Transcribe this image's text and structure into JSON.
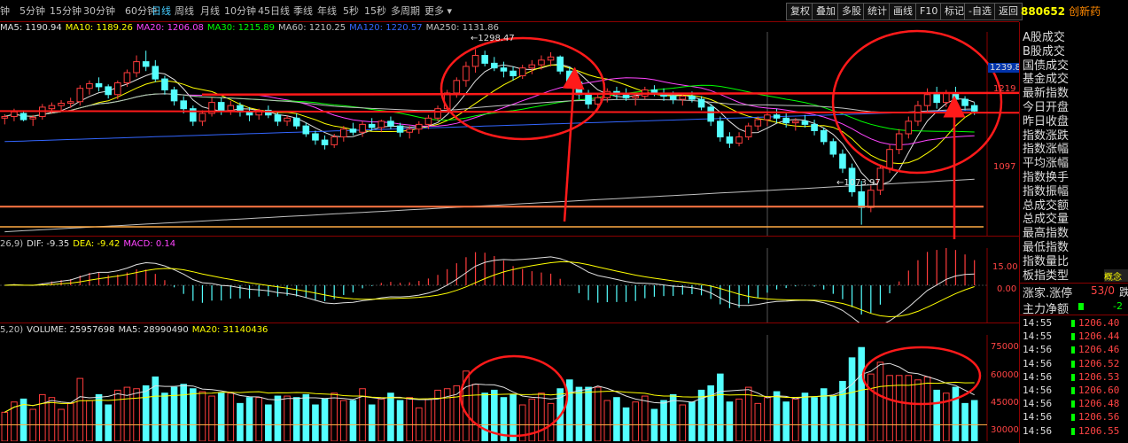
{
  "toolbar": {
    "timeframes": [
      {
        "label": "钟",
        "active": false
      },
      {
        "label": "5分钟",
        "active": false
      },
      {
        "label": "15分钟",
        "active": false
      },
      {
        "label": "30分钟",
        "active": false
      },
      {
        "label": "60分钟",
        "active": false
      },
      {
        "label": "日线",
        "active": true
      },
      {
        "label": "周线",
        "active": false
      },
      {
        "label": "月线",
        "active": false
      },
      {
        "label": "10分钟",
        "active": false
      },
      {
        "label": "45日线",
        "active": false
      },
      {
        "label": "季线",
        "active": false
      },
      {
        "label": "年线",
        "active": false
      },
      {
        "label": "5秒",
        "active": false
      },
      {
        "label": "15秒",
        "active": false
      },
      {
        "label": "多周期",
        "active": false
      },
      {
        "label": "更多 ▾",
        "active": false
      }
    ],
    "tools": [
      "复权",
      "叠加",
      "多股",
      "统计",
      "画线",
      "F10",
      "标记",
      "-自选",
      "返回"
    ]
  },
  "stock": {
    "code": "880652",
    "name": "创新药"
  },
  "price_legend": {
    "items": [
      {
        "text": "MA5: 1190.94",
        "color": "#e0e0e0"
      },
      {
        "text": "MA10: 1189.26",
        "color": "#ffff00"
      },
      {
        "text": "MA20: 1206.08",
        "color": "#ff44ff"
      },
      {
        "text": "MA30: 1215.89",
        "color": "#00ff00"
      },
      {
        "text": "MA60: 1210.25",
        "color": "#c0c0c0"
      },
      {
        "text": "MA120: 1220.57",
        "color": "#3366ff"
      },
      {
        "text": "MA250: 1131.86",
        "color": "#c0c0c0"
      }
    ]
  },
  "macd_legend": {
    "items": [
      {
        "text": "26,9)",
        "color": "#c0c0c0"
      },
      {
        "text": "DIF: -9.35",
        "color": "#e0e0e0"
      },
      {
        "text": "DEA: -9.42",
        "color": "#ffff00"
      },
      {
        "text": "MACD: 0.14",
        "color": "#ff44ff"
      }
    ]
  },
  "vol_legend": {
    "items": [
      {
        "text": "5,20)",
        "color": "#c0c0c0"
      },
      {
        "text": "VOLUME: 25957698",
        "color": "#e0e0e0"
      },
      {
        "text": "MA5: 28990490",
        "color": "#e0e0e0"
      },
      {
        "text": "MA20: 31140436",
        "color": "#ffff00"
      }
    ]
  },
  "annotations": {
    "high": "1298.47",
    "low": "1073.97"
  },
  "axes": {
    "price_labels": [
      "1239.8",
      "1219",
      "1097"
    ],
    "macd_labels": [
      "15.00",
      "0.00"
    ],
    "vol_labels": [
      "75000",
      "60000",
      "45000",
      "30000"
    ]
  },
  "side": {
    "items": [
      "A股成交",
      "B股成交",
      "国债成交",
      "基金成交",
      "最新指数",
      "今日开盘",
      "昨日收盘",
      "指数涨跌",
      "指数涨幅",
      "平均涨幅",
      "指数换手",
      "指数振幅",
      "总成交额",
      "总成交量",
      "最高指数",
      "最低指数",
      "指数量比",
      "板指类型"
    ],
    "concept": "概念",
    "updown_label": "涨家.涨停",
    "updown_value": "53/0",
    "down_label": "跌家",
    "net_label": "主力净额",
    "net_value": "-2"
  },
  "ticks": [
    {
      "time": "14:55",
      "price": "1206.40"
    },
    {
      "time": "14:55",
      "price": "1206.44"
    },
    {
      "time": "14:56",
      "price": "1206.46"
    },
    {
      "time": "14:56",
      "price": "1206.52"
    },
    {
      "time": "14:56",
      "price": "1206.53"
    },
    {
      "time": "14:56",
      "price": "1206.60"
    },
    {
      "time": "14:56",
      "price": "1206.48"
    },
    {
      "time": "14:56",
      "price": "1206.56"
    },
    {
      "time": "14:56",
      "price": "1206.55"
    }
  ],
  "chart_data": {
    "type": "candlestick",
    "price": {
      "ylim": [
        1060,
        1320
      ],
      "ohlc": [
        [
          1210,
          1215,
          1202,
          1212
        ],
        [
          1212,
          1222,
          1206,
          1218
        ],
        [
          1216,
          1220,
          1206,
          1208
        ],
        [
          1209,
          1214,
          1200,
          1211
        ],
        [
          1212,
          1228,
          1208,
          1224
        ],
        [
          1222,
          1230,
          1216,
          1226
        ],
        [
          1226,
          1233,
          1220,
          1229
        ],
        [
          1229,
          1236,
          1223,
          1231
        ],
        [
          1231,
          1252,
          1226,
          1248
        ],
        [
          1248,
          1258,
          1240,
          1254
        ],
        [
          1254,
          1262,
          1244,
          1250
        ],
        [
          1250,
          1253,
          1235,
          1240
        ],
        [
          1240,
          1258,
          1234,
          1255
        ],
        [
          1255,
          1272,
          1250,
          1268
        ],
        [
          1268,
          1290,
          1262,
          1282
        ],
        [
          1282,
          1296,
          1270,
          1276
        ],
        [
          1276,
          1284,
          1256,
          1260
        ],
        [
          1260,
          1264,
          1240,
          1246
        ],
        [
          1246,
          1250,
          1226,
          1232
        ],
        [
          1232,
          1238,
          1216,
          1222
        ],
        [
          1222,
          1226,
          1200,
          1206
        ],
        [
          1206,
          1220,
          1200,
          1216
        ],
        [
          1216,
          1236,
          1212,
          1230
        ],
        [
          1230,
          1236,
          1214,
          1220
        ],
        [
          1220,
          1232,
          1214,
          1226
        ],
        [
          1226,
          1230,
          1212,
          1218
        ],
        [
          1218,
          1224,
          1206,
          1214
        ],
        [
          1214,
          1222,
          1208,
          1220
        ],
        [
          1220,
          1226,
          1210,
          1214
        ],
        [
          1214,
          1218,
          1200,
          1206
        ],
        [
          1206,
          1214,
          1200,
          1210
        ],
        [
          1210,
          1216,
          1196,
          1200
        ],
        [
          1200,
          1204,
          1186,
          1190
        ],
        [
          1190,
          1194,
          1176,
          1182
        ],
        [
          1182,
          1188,
          1170,
          1176
        ],
        [
          1176,
          1190,
          1172,
          1186
        ],
        [
          1186,
          1200,
          1180,
          1196
        ],
        [
          1196,
          1204,
          1188,
          1192
        ],
        [
          1192,
          1206,
          1186,
          1202
        ],
        [
          1202,
          1210,
          1194,
          1198
        ],
        [
          1198,
          1208,
          1192,
          1206
        ],
        [
          1206,
          1212,
          1196,
          1200
        ],
        [
          1200,
          1204,
          1186,
          1192
        ],
        [
          1192,
          1200,
          1184,
          1196
        ],
        [
          1196,
          1206,
          1190,
          1202
        ],
        [
          1202,
          1214,
          1196,
          1210
        ],
        [
          1210,
          1226,
          1206,
          1222
        ],
        [
          1222,
          1246,
          1218,
          1242
        ],
        [
          1242,
          1262,
          1236,
          1258
        ],
        [
          1258,
          1282,
          1250,
          1276
        ],
        [
          1276,
          1298,
          1268,
          1290
        ],
        [
          1290,
          1296,
          1276,
          1280
        ],
        [
          1280,
          1288,
          1270,
          1274
        ],
        [
          1274,
          1282,
          1262,
          1270
        ],
        [
          1270,
          1276,
          1258,
          1264
        ],
        [
          1264,
          1278,
          1260,
          1274
        ],
        [
          1274,
          1284,
          1266,
          1278
        ],
        [
          1278,
          1290,
          1272,
          1284
        ],
        [
          1284,
          1294,
          1276,
          1288
        ],
        [
          1288,
          1290,
          1266,
          1270
        ],
        [
          1270,
          1276,
          1250,
          1256
        ],
        [
          1256,
          1262,
          1234,
          1240
        ],
        [
          1240,
          1246,
          1222,
          1228
        ],
        [
          1228,
          1240,
          1220,
          1236
        ],
        [
          1236,
          1248,
          1230,
          1244
        ],
        [
          1244,
          1250,
          1234,
          1240
        ],
        [
          1240,
          1248,
          1232,
          1236
        ],
        [
          1236,
          1242,
          1226,
          1238
        ],
        [
          1238,
          1250,
          1234,
          1246
        ],
        [
          1246,
          1252,
          1238,
          1242
        ],
        [
          1242,
          1248,
          1232,
          1238
        ],
        [
          1238,
          1244,
          1228,
          1234
        ],
        [
          1234,
          1242,
          1226,
          1238
        ],
        [
          1238,
          1244,
          1230,
          1234
        ],
        [
          1234,
          1238,
          1220,
          1224
        ],
        [
          1224,
          1228,
          1200,
          1206
        ],
        [
          1206,
          1212,
          1180,
          1186
        ],
        [
          1186,
          1192,
          1172,
          1178
        ],
        [
          1178,
          1192,
          1174,
          1186
        ],
        [
          1186,
          1204,
          1182,
          1200
        ],
        [
          1200,
          1212,
          1194,
          1208
        ],
        [
          1208,
          1218,
          1200,
          1214
        ],
        [
          1214,
          1222,
          1204,
          1210
        ],
        [
          1210,
          1216,
          1198,
          1204
        ],
        [
          1204,
          1210,
          1194,
          1206
        ],
        [
          1206,
          1214,
          1198,
          1202
        ],
        [
          1202,
          1208,
          1188,
          1194
        ],
        [
          1194,
          1198,
          1176,
          1180
        ],
        [
          1180,
          1184,
          1160,
          1164
        ],
        [
          1164,
          1170,
          1140,
          1146
        ],
        [
          1146,
          1152,
          1110,
          1116
        ],
        [
          1116,
          1130,
          1074,
          1096
        ],
        [
          1096,
          1124,
          1090,
          1118
        ],
        [
          1118,
          1150,
          1112,
          1146
        ],
        [
          1146,
          1176,
          1140,
          1170
        ],
        [
          1170,
          1196,
          1164,
          1190
        ],
        [
          1190,
          1212,
          1184,
          1206
        ],
        [
          1206,
          1232,
          1200,
          1226
        ],
        [
          1226,
          1248,
          1218,
          1240
        ],
        [
          1240,
          1250,
          1222,
          1230
        ],
        [
          1230,
          1246,
          1224,
          1242
        ],
        [
          1242,
          1250,
          1228,
          1234
        ],
        [
          1234,
          1238,
          1220,
          1226
        ],
        [
          1226,
          1230,
          1214,
          1219
        ]
      ],
      "ma_series": [
        {
          "name": "MA5",
          "color": "#e0e0e0",
          "start": 1212,
          "end": 1190
        },
        {
          "name": "MA10",
          "color": "#ffff00",
          "start": 1214,
          "end": 1189
        },
        {
          "name": "MA20",
          "color": "#ff44ff",
          "start": 1216,
          "end": 1206
        },
        {
          "name": "MA30",
          "color": "#00ff00",
          "start": 1214,
          "end": 1216
        },
        {
          "name": "MA60",
          "color": "#c0c0c0",
          "start": 1230,
          "end": 1210
        },
        {
          "name": "MA120",
          "color": "#3366ff",
          "start": 1180,
          "end": 1220
        },
        {
          "name": "MA250",
          "color": "#c0c0c0",
          "start": 1065,
          "end": 1132
        }
      ],
      "levels": [
        1240,
        1219,
        1097,
        1060
      ]
    },
    "macd": {
      "ylim": [
        -25,
        25
      ]
    },
    "volume": {
      "ylim": [
        20000,
        85000
      ]
    }
  }
}
